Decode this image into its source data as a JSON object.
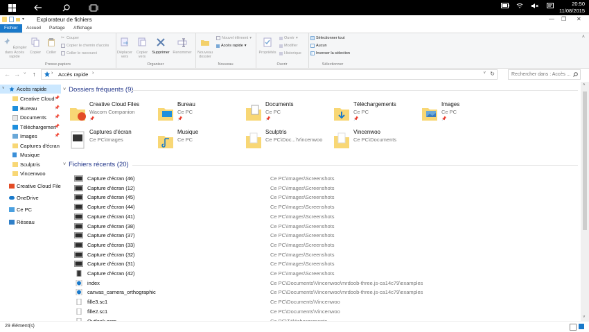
{
  "taskbar": {
    "time": "20:50",
    "date": "11/08/2015"
  },
  "window": {
    "title": "Explorateur de fichiers"
  },
  "ribbon_tabs": [
    "Fichier",
    "Accueil",
    "Partage",
    "Affichage"
  ],
  "ribbon": {
    "clipboard": {
      "pin_label": "Épingler dans Accès rapide",
      "copy_label": "Copier",
      "paste_label": "Coller",
      "cut_label": "Couper",
      "copy_path_label": "Copier le chemin d'accès",
      "paste_shortcut_label": "Coller le raccourci",
      "group_label": "Presse-papiers"
    },
    "organize": {
      "move_label": "Déplacer vers",
      "copyto_label": "Copier vers",
      "delete_label": "Supprimer",
      "rename_label": "Renommer",
      "group_label": "Organiser"
    },
    "new": {
      "folder_label": "Nouveau dossier",
      "item_label": "Nouvel élément",
      "easy_label": "Accès rapide",
      "group_label": "Nouveau"
    },
    "open": {
      "props_label": "Propriétés",
      "open_label": "Ouvrir",
      "edit_label": "Modifier",
      "history_label": "Historique",
      "group_label": "Ouvrir"
    },
    "select": {
      "all_label": "Sélectionner tout",
      "none_label": "Aucun",
      "invert_label": "Inverser la sélection",
      "group_label": "Sélectionner"
    }
  },
  "address": {
    "path": "Accès rapide",
    "search_placeholder": "Rechercher dans : Accès ..."
  },
  "sidebar": {
    "quick_access": "Accès rapide",
    "items": [
      {
        "label": "Creative Cloud",
        "pinned": true
      },
      {
        "label": "Bureau",
        "pinned": true
      },
      {
        "label": "Documents",
        "pinned": true
      },
      {
        "label": "Téléchargemen",
        "pinned": true
      },
      {
        "label": "Images",
        "pinned": true
      },
      {
        "label": "Captures d'écran",
        "pinned": false
      },
      {
        "label": "Musique",
        "pinned": false
      },
      {
        "label": "Sculptris",
        "pinned": false
      },
      {
        "label": "Vincenwoo",
        "pinned": false
      }
    ],
    "roots": [
      "Creative Cloud File",
      "OneDrive",
      "Ce PC",
      "Réseau"
    ],
    "pin_glyph": "📌"
  },
  "frequent": {
    "header": "Dossiers fréquents (9)",
    "items": [
      {
        "name": "Creative Cloud Files",
        "loc": "Wacom Companion",
        "pinned": true,
        "icon": "creative-cloud-folder-icon"
      },
      {
        "name": "Bureau",
        "loc": "Ce PC",
        "pinned": true,
        "icon": "desktop-folder-icon"
      },
      {
        "name": "Documents",
        "loc": "Ce PC",
        "pinned": true,
        "icon": "documents-folder-icon"
      },
      {
        "name": "Téléchargements",
        "loc": "Ce PC",
        "pinned": true,
        "icon": "downloads-folder-icon"
      },
      {
        "name": "Images",
        "loc": "Ce PC",
        "pinned": true,
        "icon": "pictures-folder-icon"
      },
      {
        "name": "Captures d'écran",
        "loc": "Ce PC\\Images",
        "pinned": false,
        "icon": "screenshots-folder-icon"
      },
      {
        "name": "Musique",
        "loc": "Ce PC",
        "pinned": false,
        "icon": "music-folder-icon"
      },
      {
        "name": "Sculptris",
        "loc": "Ce PC\\Doc...\\Vincenwoo",
        "pinned": false,
        "icon": "folder-icon"
      },
      {
        "name": "Vincenwoo",
        "loc": "Ce PC\\Documents",
        "pinned": false,
        "icon": "folder-icon"
      }
    ],
    "pin_glyph": "📌"
  },
  "recent": {
    "header": "Fichiers récents (20)",
    "items": [
      {
        "name": "Capture d'écran (46)",
        "path": "Ce PC\\Images\\Screenshots",
        "type": "image"
      },
      {
        "name": "Capture d'écran (12)",
        "path": "Ce PC\\Images\\Screenshots",
        "type": "image"
      },
      {
        "name": "Capture d'écran (45)",
        "path": "Ce PC\\Images\\Screenshots",
        "type": "image"
      },
      {
        "name": "Capture d'écran (44)",
        "path": "Ce PC\\Images\\Screenshots",
        "type": "image"
      },
      {
        "name": "Capture d'écran (41)",
        "path": "Ce PC\\Images\\Screenshots",
        "type": "image"
      },
      {
        "name": "Capture d'écran (38)",
        "path": "Ce PC\\Images\\Screenshots",
        "type": "image"
      },
      {
        "name": "Capture d'écran (37)",
        "path": "Ce PC\\Images\\Screenshots",
        "type": "image"
      },
      {
        "name": "Capture d'écran (33)",
        "path": "Ce PC\\Images\\Screenshots",
        "type": "image"
      },
      {
        "name": "Capture d'écran (32)",
        "path": "Ce PC\\Images\\Screenshots",
        "type": "image"
      },
      {
        "name": "Capture d'écran (31)",
        "path": "Ce PC\\Images\\Screenshots",
        "type": "image"
      },
      {
        "name": "Capture d'écran (42)",
        "path": "Ce PC\\Images\\Screenshots",
        "type": "image-portrait"
      },
      {
        "name": "index",
        "path": "Ce PC\\Documents\\Vincenwoo\\mrdoob-three.js-ca14c79\\examples",
        "type": "edge"
      },
      {
        "name": "canvas_camera_orthographic",
        "path": "Ce PC\\Documents\\Vincenwoo\\mrdoob-three.js-ca14c79\\examples",
        "type": "edge"
      },
      {
        "name": "fille3.sc1",
        "path": "Ce PC\\Documents\\Vincenwoo",
        "type": "file"
      },
      {
        "name": "fille2.sc1",
        "path": "Ce PC\\Documents\\Vincenwoo",
        "type": "file"
      },
      {
        "name": "Outlook.com",
        "path": "Ce PC\\Téléchargements",
        "type": "file"
      }
    ]
  },
  "status": {
    "count": "29 élément(s)"
  },
  "colors": {
    "accent": "#1979ca",
    "folder": "#f8d775",
    "header_text": "#1e3287"
  }
}
